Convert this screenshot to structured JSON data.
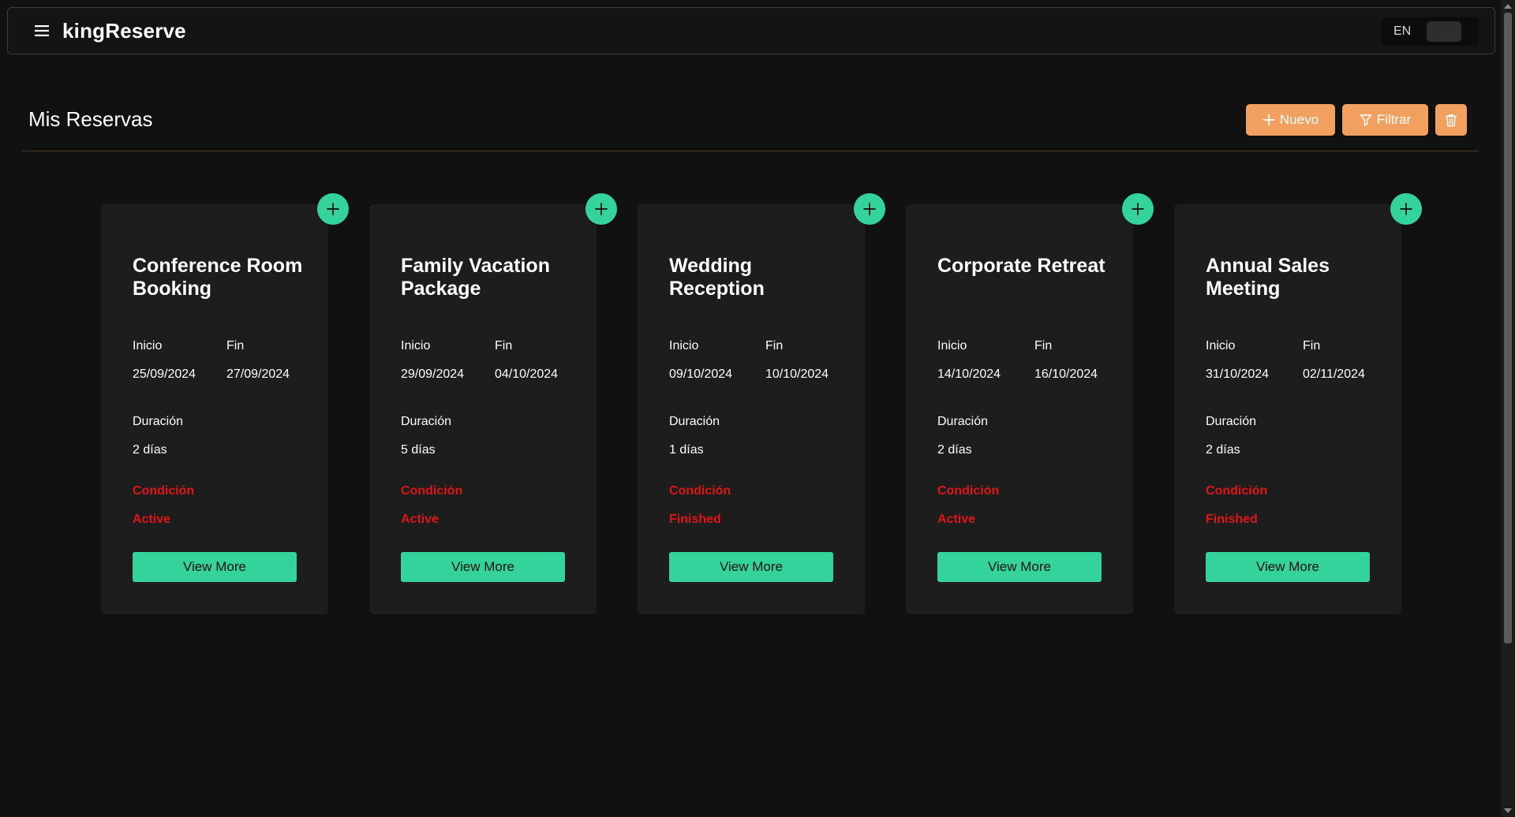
{
  "app": {
    "brand": "kingReserve",
    "language": "EN"
  },
  "page": {
    "title": "Mis Reservas",
    "actions": {
      "new_label": "Nuevo",
      "filter_label": "Filtrar"
    }
  },
  "labels": {
    "start": "Inicio",
    "end": "Fin",
    "duration": "Duración",
    "condition": "Condición",
    "view_more": "View More"
  },
  "colors": {
    "accent_green": "#33d39b",
    "accent_orange": "#f2a060",
    "condition_red": "#e01616",
    "background": "#111111",
    "card": "#1d1d1d"
  },
  "reservations": [
    {
      "title": "Conference Room Booking",
      "start": "25/09/2024",
      "end": "27/09/2024",
      "duration": "2 días",
      "status": "Active"
    },
    {
      "title": "Family Vacation Package",
      "start": "29/09/2024",
      "end": "04/10/2024",
      "duration": "5 días",
      "status": "Active"
    },
    {
      "title": "Wedding Reception",
      "start": "09/10/2024",
      "end": "10/10/2024",
      "duration": "1 días",
      "status": "Finished"
    },
    {
      "title": "Corporate Retreat",
      "start": "14/10/2024",
      "end": "16/10/2024",
      "duration": "2 días",
      "status": "Active"
    },
    {
      "title": "Annual Sales Meeting",
      "start": "31/10/2024",
      "end": "02/11/2024",
      "duration": "2 días",
      "status": "Finished"
    }
  ]
}
